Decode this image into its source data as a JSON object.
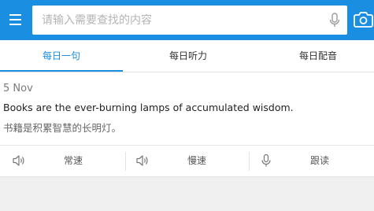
{
  "search": {
    "placeholder": "请输入需要查找的内容"
  },
  "tabs": [
    {
      "label": "每日一句",
      "active": true
    },
    {
      "label": "每日听力",
      "active": false
    },
    {
      "label": "每日配音",
      "active": false
    }
  ],
  "sentence": {
    "date": "5 Nov",
    "english": "Books are the ever-burning lamps of accumulated wisdom.",
    "chinese": "书籍是积累智慧的长明灯。"
  },
  "controls": {
    "normal_speed": "常速",
    "slow_speed": "慢速",
    "follow_read": "跟读"
  },
  "colors": {
    "accent": "#1a8ee1"
  }
}
